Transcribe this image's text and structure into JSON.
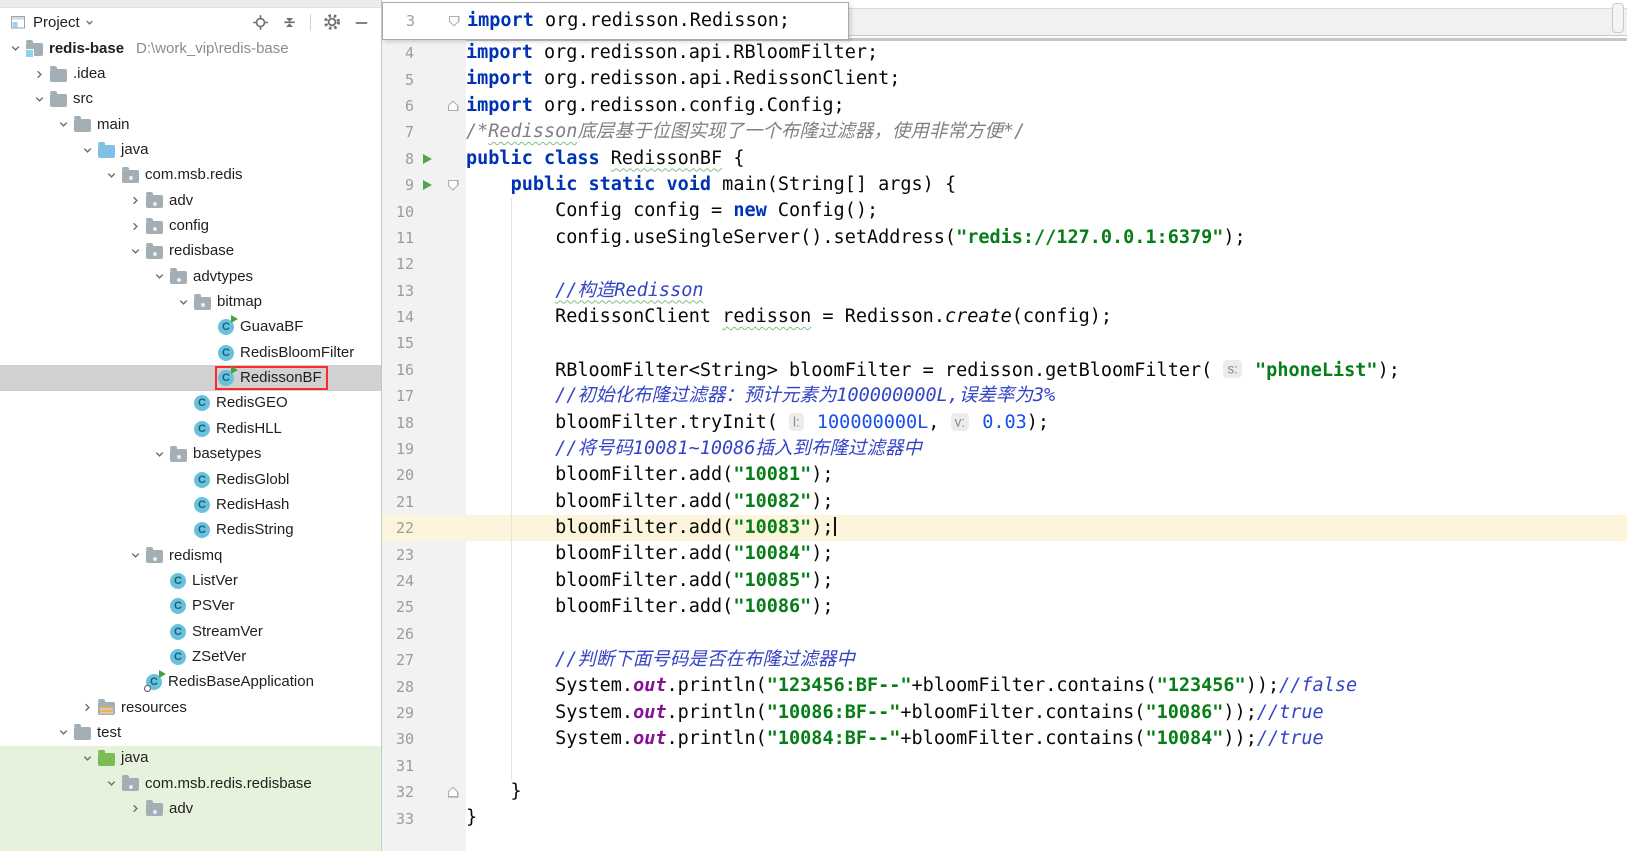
{
  "panel": {
    "title": "Project",
    "toolbar_icons": [
      "locate",
      "collapse-all",
      "settings",
      "hide"
    ]
  },
  "colors": {
    "keyword": "#0033B3",
    "string": "#067D17",
    "number": "#1750EB",
    "line_comment": "#3344C5",
    "block_comment": "#808080",
    "static_field": "#871094",
    "caret_line_bg": "#FCF5DC",
    "selected_row_bg": "#D1D1D1",
    "test_source_row_bg": "#E7F2DC",
    "run_arrow": "#4FA84F",
    "red_box": "#FB2A2A",
    "class_icon_bg": "#6AC1DB"
  },
  "tree": [
    {
      "label": "redis-base",
      "path": "D:\\work_vip\\redis-base",
      "level": 0,
      "icon": "folder-project",
      "chevron": "down",
      "bold": true
    },
    {
      "label": ".idea",
      "level": 1,
      "icon": "folder",
      "chevron": "right"
    },
    {
      "label": "src",
      "level": 1,
      "icon": "folder",
      "chevron": "down"
    },
    {
      "label": "main",
      "level": 2,
      "icon": "folder",
      "chevron": "down"
    },
    {
      "label": "java",
      "level": 3,
      "icon": "folder-source",
      "chevron": "down"
    },
    {
      "label": "com.msb.redis",
      "level": 4,
      "icon": "package",
      "chevron": "down"
    },
    {
      "label": "adv",
      "level": 5,
      "icon": "package",
      "chevron": "right"
    },
    {
      "label": "config",
      "level": 5,
      "icon": "package",
      "chevron": "right"
    },
    {
      "label": "redisbase",
      "level": 5,
      "icon": "package",
      "chevron": "down"
    },
    {
      "label": "advtypes",
      "level": 6,
      "icon": "package",
      "chevron": "down"
    },
    {
      "label": "bitmap",
      "level": 7,
      "icon": "package",
      "chevron": "down"
    },
    {
      "label": "GuavaBF",
      "level": 8,
      "icon": "class-run"
    },
    {
      "label": "RedisBloomFilter",
      "level": 8,
      "icon": "class"
    },
    {
      "label": "RedissonBF",
      "level": 8,
      "icon": "class-run",
      "selected": true,
      "redbox": true
    },
    {
      "label": "RedisGEO",
      "level": 7,
      "icon": "class"
    },
    {
      "label": "RedisHLL",
      "level": 7,
      "icon": "class"
    },
    {
      "label": "basetypes",
      "level": 6,
      "icon": "package",
      "chevron": "down"
    },
    {
      "label": "RedisGlobl",
      "level": 7,
      "icon": "class"
    },
    {
      "label": "RedisHash",
      "level": 7,
      "icon": "class"
    },
    {
      "label": "RedisString",
      "level": 7,
      "icon": "class"
    },
    {
      "label": "redismq",
      "level": 5,
      "icon": "package",
      "chevron": "down"
    },
    {
      "label": "ListVer",
      "level": 6,
      "icon": "class"
    },
    {
      "label": "PSVer",
      "level": 6,
      "icon": "class"
    },
    {
      "label": "StreamVer",
      "level": 6,
      "icon": "class"
    },
    {
      "label": "ZSetVer",
      "level": 6,
      "icon": "class"
    },
    {
      "label": "RedisBaseApplication",
      "level": 5,
      "icon": "class-run-app"
    },
    {
      "label": "resources",
      "level": 3,
      "icon": "folder-resources",
      "chevron": "right"
    },
    {
      "label": "test",
      "level": 2,
      "icon": "folder",
      "chevron": "down"
    },
    {
      "label": "java",
      "level": 3,
      "icon": "folder-test",
      "chevron": "down",
      "green": true
    },
    {
      "label": "com.msb.redis.redisbase",
      "level": 4,
      "icon": "package",
      "chevron": "down",
      "green": true
    },
    {
      "label": "adv",
      "level": 5,
      "icon": "package",
      "chevron": "right",
      "green": true
    }
  ],
  "editor": {
    "sticky_line": {
      "n": 3,
      "fold": "down",
      "segs": [
        [
          "import",
          "k"
        ],
        [
          " org.redisson.Redisson;",
          ""
        ]
      ]
    },
    "lines": [
      {
        "n": 4,
        "segs": [
          [
            "import",
            "k"
          ],
          [
            " org.redisson.api.RBloomFilter;",
            ""
          ]
        ]
      },
      {
        "n": 5,
        "segs": [
          [
            "import",
            "k"
          ],
          [
            " org.redisson.api.RedissonClient;",
            ""
          ]
        ]
      },
      {
        "n": 6,
        "fold": "up",
        "segs": [
          [
            "import",
            "k"
          ],
          [
            " org.redisson.config.Config;",
            ""
          ]
        ]
      },
      {
        "n": 7,
        "segs": [
          [
            "/*",
            "b"
          ],
          [
            "Redisson",
            "b w"
          ],
          [
            "底层基于位图实现了一个布隆过滤器，使用非常方便*/",
            "b"
          ]
        ]
      },
      {
        "n": 8,
        "run": true,
        "segs": [
          [
            "public class",
            "k"
          ],
          [
            " ",
            ""
          ],
          [
            "RedissonBF",
            "w"
          ],
          [
            " {",
            ""
          ]
        ]
      },
      {
        "n": 9,
        "run": true,
        "fold": "down",
        "segs": [
          [
            "    ",
            ""
          ],
          [
            "public static void",
            "k"
          ],
          [
            " main(String[] args) {",
            ""
          ]
        ]
      },
      {
        "n": 10,
        "segs": [
          [
            "        Config config = ",
            ""
          ],
          [
            "new",
            "k"
          ],
          [
            " Config();",
            ""
          ]
        ]
      },
      {
        "n": 11,
        "segs": [
          [
            "        config.useSingleServer().setAddress(",
            ""
          ],
          [
            "\"redis://127.0.0.1:6379\"",
            "s"
          ],
          [
            ");",
            ""
          ]
        ]
      },
      {
        "n": 12,
        "segs": []
      },
      {
        "n": 13,
        "segs": [
          [
            "        ",
            ""
          ],
          [
            "//构造Redisson",
            "c w"
          ]
        ]
      },
      {
        "n": 14,
        "segs": [
          [
            "        RedissonClient ",
            ""
          ],
          [
            "redisson",
            "w"
          ],
          [
            " = Redisson.",
            ""
          ],
          [
            "create",
            "i"
          ],
          [
            "(config);",
            ""
          ]
        ]
      },
      {
        "n": 15,
        "segs": []
      },
      {
        "n": 16,
        "segs": [
          [
            "        RBloomFilter<String> bloomFilter = redisson.getBloomFilter( ",
            ""
          ],
          [
            "s:",
            "h"
          ],
          [
            " ",
            ""
          ],
          [
            "\"phoneList\"",
            "s"
          ],
          [
            ");",
            ""
          ]
        ]
      },
      {
        "n": 17,
        "segs": [
          [
            "        ",
            ""
          ],
          [
            "//初始化布隆过滤器：预计元素为100000000L,误差率为3%",
            "c"
          ]
        ]
      },
      {
        "n": 18,
        "segs": [
          [
            "        bloomFilter.tryInit( ",
            ""
          ],
          [
            "l:",
            "h"
          ],
          [
            " ",
            ""
          ],
          [
            "100000000L",
            "n"
          ],
          [
            ", ",
            ""
          ],
          [
            "v:",
            "h"
          ],
          [
            " ",
            ""
          ],
          [
            "0.03",
            "n"
          ],
          [
            ");",
            ""
          ]
        ]
      },
      {
        "n": 19,
        "segs": [
          [
            "        ",
            ""
          ],
          [
            "//将号码10081~10086插入到布隆过滤器中",
            "c"
          ]
        ]
      },
      {
        "n": 20,
        "segs": [
          [
            "        bloomFilter.add(",
            ""
          ],
          [
            "\"10081\"",
            "s"
          ],
          [
            ");",
            ""
          ]
        ]
      },
      {
        "n": 21,
        "segs": [
          [
            "        bloomFilter.add(",
            ""
          ],
          [
            "\"10082\"",
            "s"
          ],
          [
            ");",
            ""
          ]
        ]
      },
      {
        "n": 22,
        "cur": true,
        "caret": true,
        "segs": [
          [
            "        bloomFilter.add(",
            ""
          ],
          [
            "\"10083\"",
            "s"
          ],
          [
            ");",
            ""
          ]
        ]
      },
      {
        "n": 23,
        "segs": [
          [
            "        bloomFilter.add(",
            ""
          ],
          [
            "\"10084\"",
            "s"
          ],
          [
            ");",
            ""
          ]
        ]
      },
      {
        "n": 24,
        "segs": [
          [
            "        bloomFilter.add(",
            ""
          ],
          [
            "\"10085\"",
            "s"
          ],
          [
            ");",
            ""
          ]
        ]
      },
      {
        "n": 25,
        "segs": [
          [
            "        bloomFilter.add(",
            ""
          ],
          [
            "\"10086\"",
            "s"
          ],
          [
            ");",
            ""
          ]
        ]
      },
      {
        "n": 26,
        "segs": []
      },
      {
        "n": 27,
        "segs": [
          [
            "        ",
            ""
          ],
          [
            "//判断下面号码是否在布隆过滤器中",
            "c"
          ]
        ]
      },
      {
        "n": 28,
        "segs": [
          [
            "        System.",
            ""
          ],
          [
            "out",
            "f"
          ],
          [
            ".println(",
            ""
          ],
          [
            "\"123456:BF--\"",
            "s"
          ],
          [
            "+bloomFilter.contains(",
            ""
          ],
          [
            "\"123456\"",
            "s"
          ],
          [
            "));",
            ""
          ],
          [
            "//false",
            "c"
          ]
        ]
      },
      {
        "n": 29,
        "segs": [
          [
            "        System.",
            ""
          ],
          [
            "out",
            "f"
          ],
          [
            ".println(",
            ""
          ],
          [
            "\"10086:BF--\"",
            "s"
          ],
          [
            "+bloomFilter.contains(",
            ""
          ],
          [
            "\"10086\"",
            "s"
          ],
          [
            "));",
            ""
          ],
          [
            "//true",
            "c"
          ]
        ]
      },
      {
        "n": 30,
        "segs": [
          [
            "        System.",
            ""
          ],
          [
            "out",
            "f"
          ],
          [
            ".println(",
            ""
          ],
          [
            "\"10084:BF--\"",
            "s"
          ],
          [
            "+bloomFilter.contains(",
            ""
          ],
          [
            "\"10084\"",
            "s"
          ],
          [
            "));",
            ""
          ],
          [
            "//true",
            "c"
          ]
        ]
      },
      {
        "n": 31,
        "segs": []
      },
      {
        "n": 32,
        "fold": "up",
        "segs": [
          [
            "    }",
            ""
          ]
        ]
      },
      {
        "n": 33,
        "segs": [
          [
            "}",
            ""
          ]
        ]
      }
    ]
  }
}
